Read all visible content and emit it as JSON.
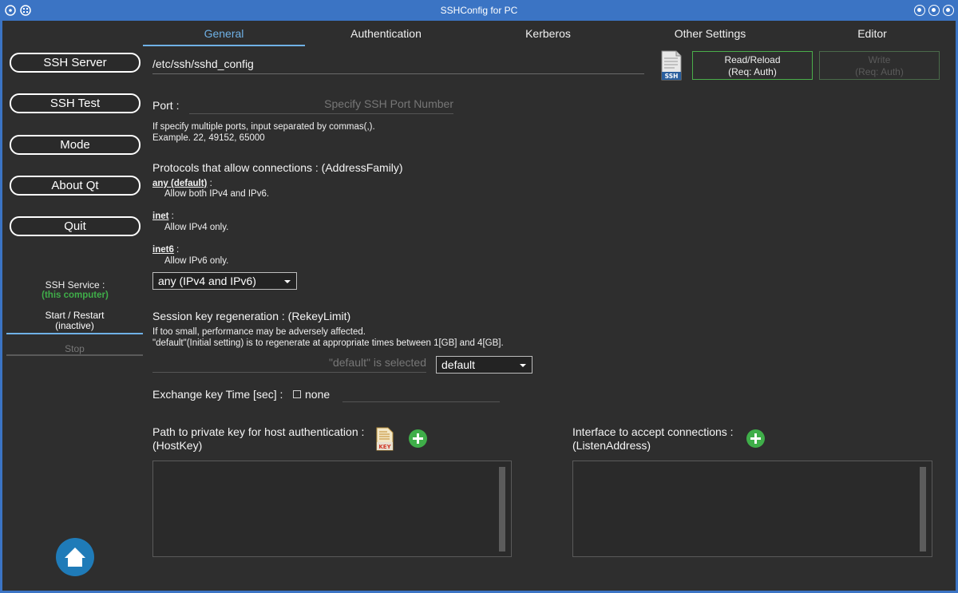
{
  "window": {
    "title": "SSHConfig for PC"
  },
  "sidebar": {
    "buttons": [
      "SSH Server",
      "SSH Test",
      "Mode",
      "About Qt",
      "Quit"
    ],
    "service_label": "SSH Service :",
    "service_sub": "(this computer)",
    "start_restart": "Start / Restart",
    "status": "(inactive)",
    "stop": "Stop"
  },
  "tabs": [
    "General",
    "Authentication",
    "Kerberos",
    "Other Settings",
    "Editor"
  ],
  "active_tab": "General",
  "config_path": "/etc/ssh/sshd_config",
  "actions": {
    "read_reload": [
      "Read/Reload",
      "(Req: Auth)"
    ],
    "write": [
      "Write",
      "(Req: Auth)"
    ]
  },
  "port": {
    "label": "Port :",
    "placeholder": "Specify SSH Port Number",
    "help1": "If specify multiple ports, input separated by commas(,).",
    "help2": "Example. 22, 49152, 65000"
  },
  "protocols": {
    "heading": "Protocols that allow connections : (AddressFamily)",
    "items": [
      {
        "name": "any (default)",
        "desc": "Allow both IPv4 and IPv6."
      },
      {
        "name": "inet",
        "desc": "Allow IPv4 only."
      },
      {
        "name": "inet6",
        "desc": "Allow IPv6 only."
      }
    ],
    "selected": "any (IPv4 and IPv6)"
  },
  "rekey": {
    "heading": "Session key regeneration : (RekeyLimit)",
    "help1": "If too small, performance may be adversely affected.",
    "help2": "\"default\"(Initial setting) is to regenerate at appropriate times between 1[GB] and 4[GB].",
    "placeholder": "\"default\" is selected",
    "selected": "default"
  },
  "exchange": {
    "label": "Exchange key Time [sec] :",
    "checkbox_label": "none"
  },
  "hostkey": {
    "label1": "Path to private key for host authentication :",
    "label2": "(HostKey)"
  },
  "listen": {
    "label1": "Interface to accept connections :",
    "label2": "(ListenAddress)"
  },
  "colors": {
    "accent": "#6fb1e6",
    "green": "#3fae49",
    "titlebar": "#3b74c4"
  },
  "icons": [
    "ssh-file-icon",
    "key-file-icon",
    "add-icon",
    "home-icon"
  ]
}
